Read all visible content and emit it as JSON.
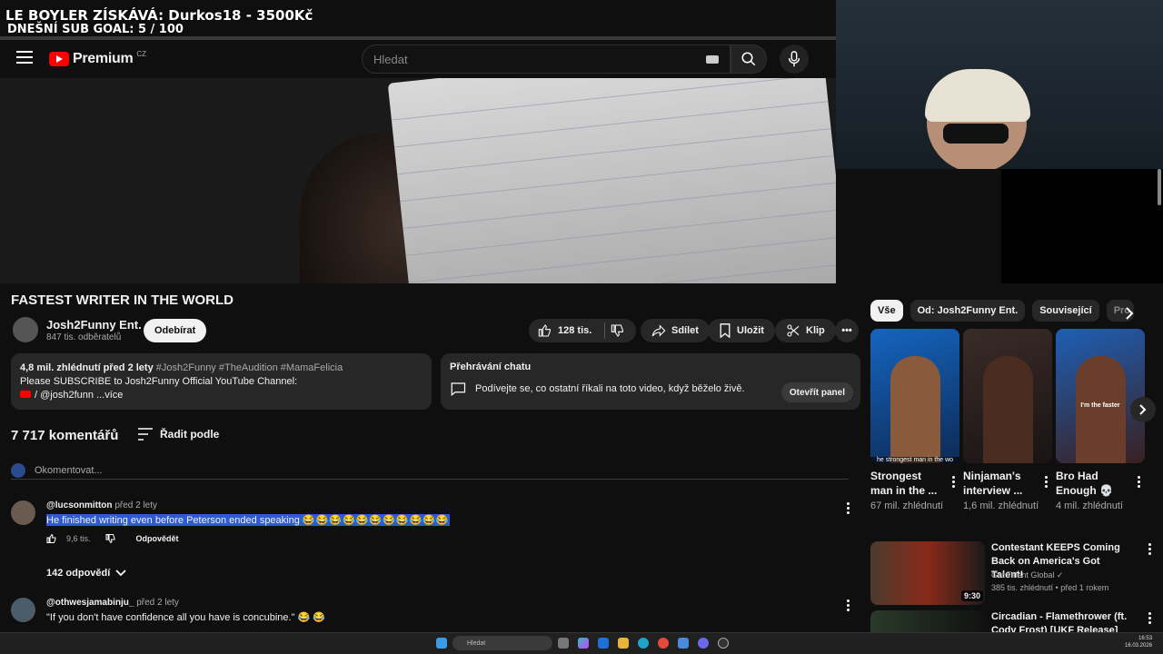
{
  "overlay": {
    "line1": "LE BOYLER ZÍSKÁVÁ: Durkos18 - 3500Kč",
    "line2": "DNEŠNÍ SUB GOAL: 5 / 100"
  },
  "header": {
    "logo_text": "Premium",
    "logo_region": "CZ",
    "search_placeholder": "Hledat"
  },
  "video": {
    "title": "FASTEST WRITER IN THE WORLD"
  },
  "channel": {
    "name": "Josh2Funny Ent.",
    "subscribers": "847 tis. odběratelů",
    "subscribe_label": "Odebírat"
  },
  "actions": {
    "likes": "128 tis.",
    "share": "Sdílet",
    "save": "Uložit",
    "clip": "Klip"
  },
  "description": {
    "meta": "4,8 mil. zhlédnutí  před 2 lety",
    "tags": "#Josh2Funny #TheAudition #MamaFelicia",
    "line1": "Please SUBSCRIBE to Josh2Funny Official YouTube Channel:",
    "line2": "/ @josh2funn  ...více"
  },
  "chat_replay": {
    "heading": "Přehrávání chatu",
    "text": "Podívejte se, co ostatní říkali na toto video, když běželo živě.",
    "button": "Otevřít panel"
  },
  "comments": {
    "count": "7 717 komentářů",
    "sort_label": "Řadit podle",
    "add_placeholder": "Okomentovat...",
    "items": [
      {
        "author": "@lucsonmitton",
        "time": "před 2 lety",
        "text": "He finished writing even before Peterson ended speaking",
        "emoji": "😂😂😂😂😂😂😂😂😂😂😂",
        "likes": "9,6 tis.",
        "reply": "Odpovědět",
        "replies": "142 odpovědí"
      },
      {
        "author": "@othwesjamabinju_",
        "time": "před 2 lety",
        "text": "\"If you don't have confidence all you have is concubine.\" 😂 😂"
      }
    ]
  },
  "chips": [
    "Vše",
    "Od: Josh2Funny Ent.",
    "Související",
    "Pro"
  ],
  "shorts": [
    {
      "title": "Strongest man in the ...",
      "views": "67 mil. zhlédnutí",
      "caption": "he strongest man in the wo"
    },
    {
      "title": "Ninjaman's interview ...",
      "views": "1,6 mil. zhlédnutí",
      "caption": ""
    },
    {
      "title": "Bro Had Enough 💀",
      "views": "4 mil. zhlédnutí",
      "caption": "I'm the faster"
    }
  ],
  "related": [
    {
      "title": "Contestant KEEPS Coming Back on America's Got Talent!",
      "channel": "Got Talent Global ✓",
      "meta": "385 tis. zhlédnutí • před 1 rokem",
      "duration": "9:30"
    },
    {
      "title": "Circadian - Flamethrower (ft. Cody Frost) [UKF Release]",
      "channel": "",
      "meta": "",
      "duration": ""
    }
  ],
  "taskbar": {
    "search": "Hledat",
    "time": "16:53",
    "date": "16.03.2026"
  }
}
